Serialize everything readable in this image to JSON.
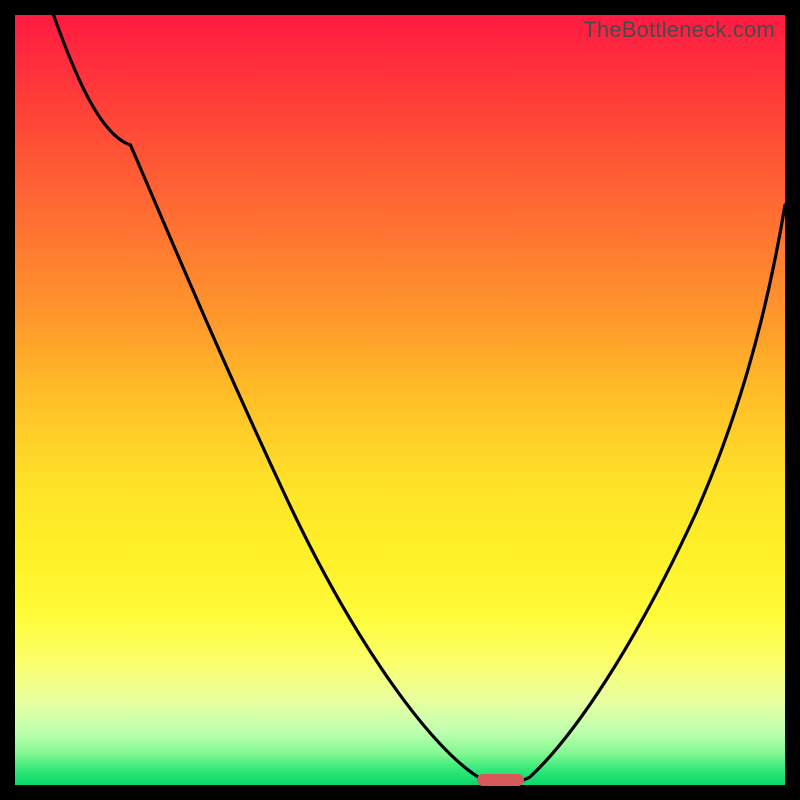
{
  "watermark": "TheBottleneck.com",
  "chart_data": {
    "type": "line",
    "title": "",
    "xlabel": "",
    "ylabel": "",
    "xlim": [
      0,
      100
    ],
    "ylim": [
      0,
      100
    ],
    "grid": false,
    "series": [
      {
        "name": "bottleneck-curve",
        "x": [
          5,
          10,
          15,
          20,
          25,
          30,
          35,
          40,
          45,
          50,
          55,
          60,
          65,
          70,
          75,
          80,
          85,
          90,
          95,
          100
        ],
        "values": [
          100,
          94,
          87,
          81,
          74,
          66,
          58,
          50,
          41,
          31,
          20,
          7,
          0,
          7,
          18,
          30,
          42,
          54,
          66,
          78
        ]
      }
    ],
    "marker": {
      "x": 63,
      "y": 0,
      "width_pct": 6
    },
    "gradient_stops": [
      {
        "pct": 0,
        "color": "#ff1a42"
      },
      {
        "pct": 50,
        "color": "#ffd028"
      },
      {
        "pct": 80,
        "color": "#fffb3a"
      },
      {
        "pct": 100,
        "color": "#08d868"
      }
    ]
  }
}
